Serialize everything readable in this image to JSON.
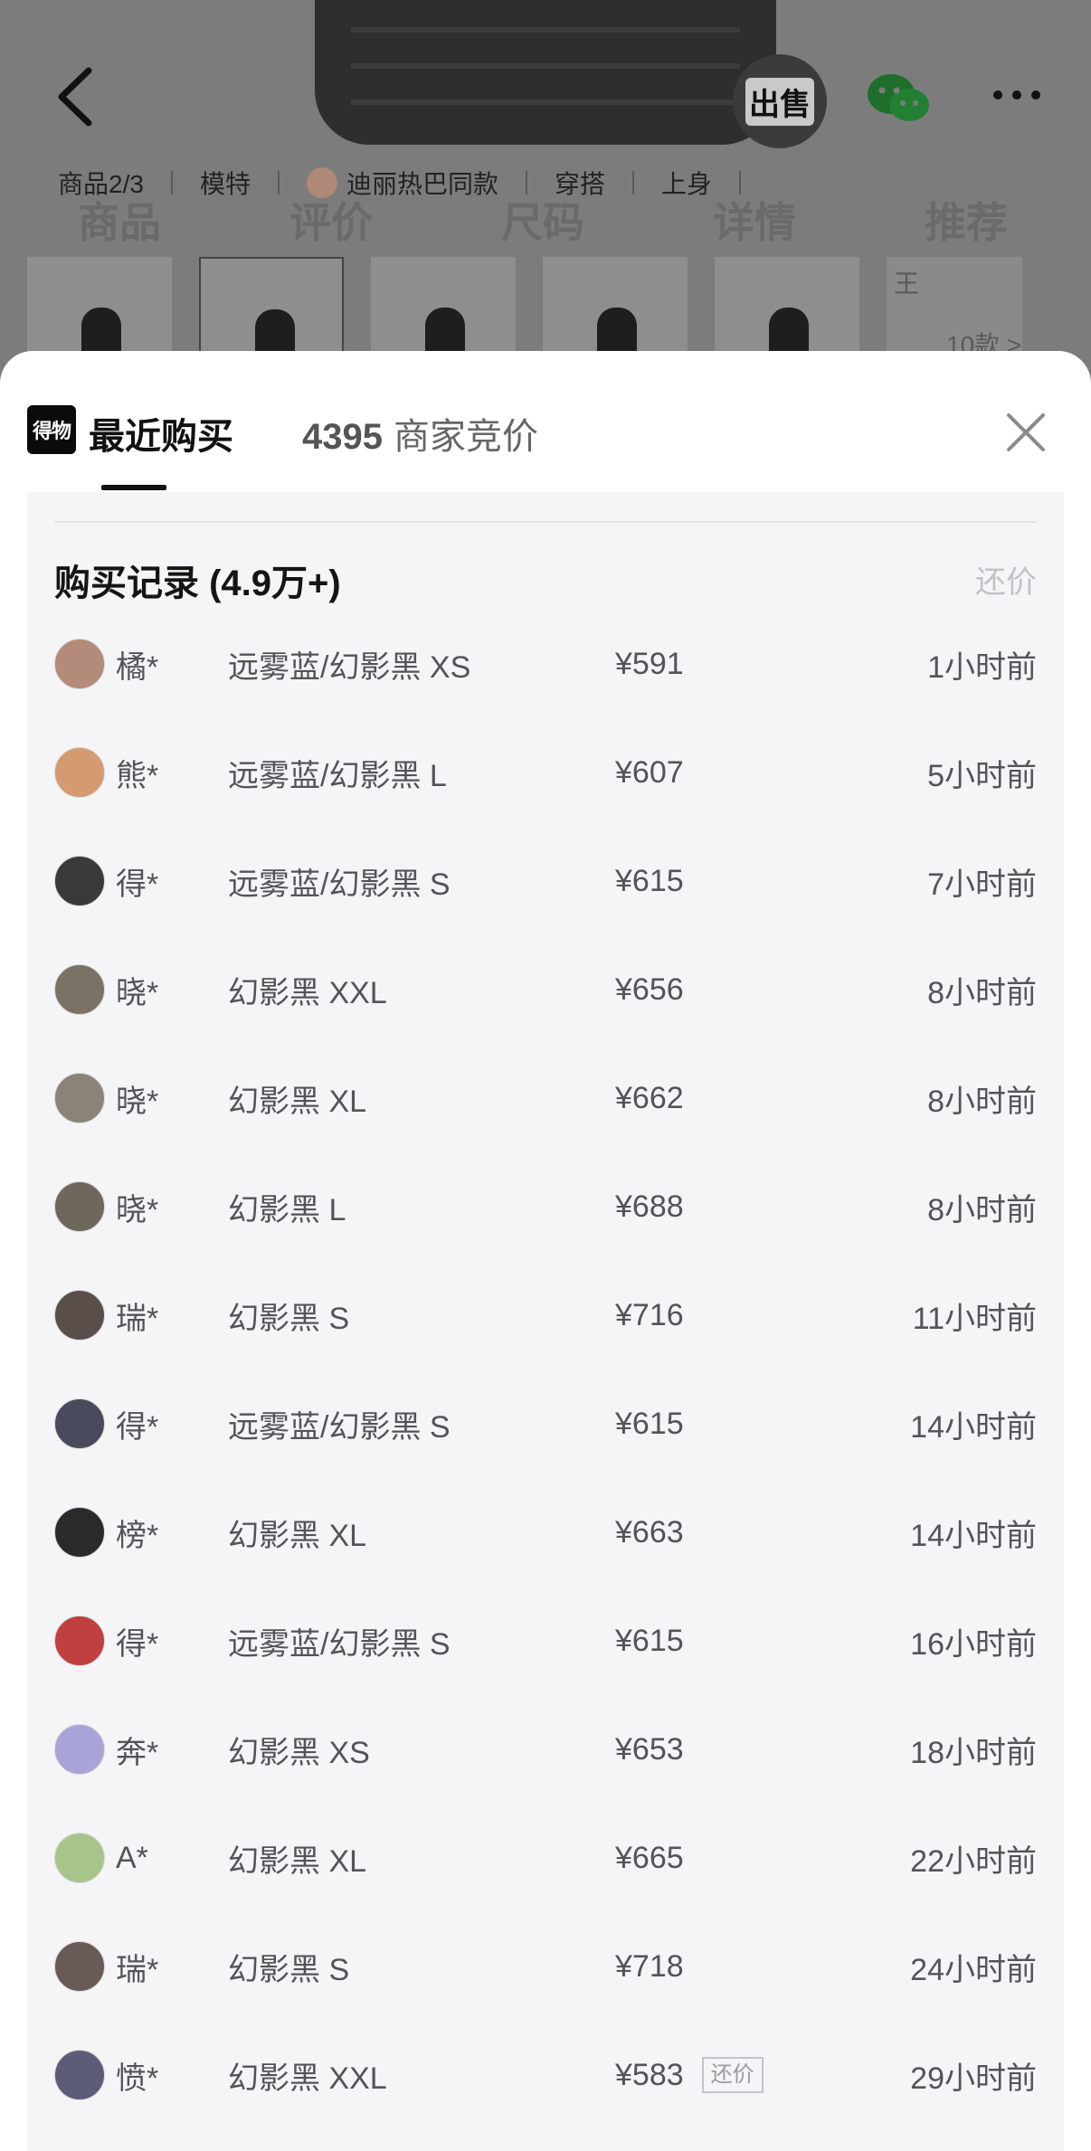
{
  "background": {
    "tags": [
      "商品2/3",
      "模特",
      "迪丽热巴同款",
      "穿搭",
      "上身"
    ],
    "anchors": [
      "商品",
      "评价",
      "尺码",
      "详情",
      "推荐"
    ],
    "sell_label": "出售",
    "more_styles": "10款 >",
    "more_styles_prefix": "王"
  },
  "sheet": {
    "brand": "得物",
    "tab_recent": "最近购买",
    "tab_bids_count": "4395",
    "tab_bids_label": "商家竞价",
    "records_title": "购买记录 (4.9万+)",
    "offer_link": "还价"
  },
  "records": [
    {
      "buyer": "橘*",
      "variant": "远雾蓝/幻影黑 XS",
      "price": "¥591",
      "time": "1小时前",
      "avatar_color": "#b48a7a"
    },
    {
      "buyer": "熊*",
      "variant": "远雾蓝/幻影黑 L",
      "price": "¥607",
      "time": "5小时前",
      "avatar_color": "#d69a70"
    },
    {
      "buyer": "得*",
      "variant": "远雾蓝/幻影黑 S",
      "price": "¥615",
      "time": "7小时前",
      "avatar_color": "#3a3a3a"
    },
    {
      "buyer": "晓*",
      "variant": "幻影黑 XXL",
      "price": "¥656",
      "time": "8小时前",
      "avatar_color": "#7a7264"
    },
    {
      "buyer": "晓*",
      "variant": "幻影黑 XL",
      "price": "¥662",
      "time": "8小时前",
      "avatar_color": "#8a8378"
    },
    {
      "buyer": "晓*",
      "variant": "幻影黑 L",
      "price": "¥688",
      "time": "8小时前",
      "avatar_color": "#6e675c"
    },
    {
      "buyer": "瑞*",
      "variant": "幻影黑 S",
      "price": "¥716",
      "time": "11小时前",
      "avatar_color": "#5a4e4a"
    },
    {
      "buyer": "得*",
      "variant": "远雾蓝/幻影黑 S",
      "price": "¥615",
      "time": "14小时前",
      "avatar_color": "#4a4a5e"
    },
    {
      "buyer": "榜*",
      "variant": "幻影黑 XL",
      "price": "¥663",
      "time": "14小时前",
      "avatar_color": "#2a2a2a"
    },
    {
      "buyer": "得*",
      "variant": "远雾蓝/幻影黑 S",
      "price": "¥615",
      "time": "16小时前",
      "avatar_color": "#c04040"
    },
    {
      "buyer": "奔*",
      "variant": "幻影黑 XS",
      "price": "¥653",
      "time": "18小时前",
      "avatar_color": "#a8a4d8"
    },
    {
      "buyer": "A*",
      "variant": "幻影黑 XL",
      "price": "¥665",
      "time": "22小时前",
      "avatar_color": "#a9c48a"
    },
    {
      "buyer": "瑞*",
      "variant": "幻影黑 S",
      "price": "¥718",
      "time": "24小时前",
      "avatar_color": "#6a5a55"
    },
    {
      "buyer": "愤*",
      "variant": "幻影黑 XXL",
      "price": "¥583",
      "time": "29小时前",
      "avatar_color": "#5c5c78",
      "tag": "还价"
    }
  ]
}
